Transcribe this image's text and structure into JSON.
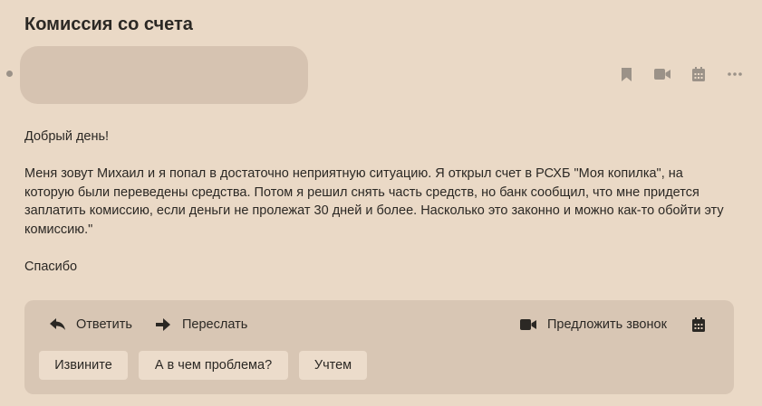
{
  "message": {
    "subject": "Комиссия со счета",
    "body": [
      "Добрый день!",
      "Меня зовут Михаил и я попал в достаточно неприятную ситуацию. Я открыл счет в РСХБ \"Моя копилка\", на которую были переведены средства. Потом я решил снять часть средств, но банк сообщил, что мне придется заплатить комиссию, если деньги не пролежат 30 дней и более. Насколько это законно и можно как-то обойти эту комиссию.\"",
      "Спасибо"
    ]
  },
  "header_actions": {
    "icons": [
      "bookmark-icon",
      "video-camera-icon",
      "calendar-icon",
      "more-icon"
    ]
  },
  "reply_panel": {
    "reply_label": "Ответить",
    "forward_label": "Переслать",
    "call_label": "Предложить звонок",
    "quick_replies": [
      "Извините",
      "А в чем проблема?",
      "Учтем"
    ]
  },
  "colors": {
    "background": "#ead9c6",
    "panel": "#d8c6b4",
    "button": "#ecdccb",
    "text": "#2b2824",
    "icon": "#9b9288"
  }
}
